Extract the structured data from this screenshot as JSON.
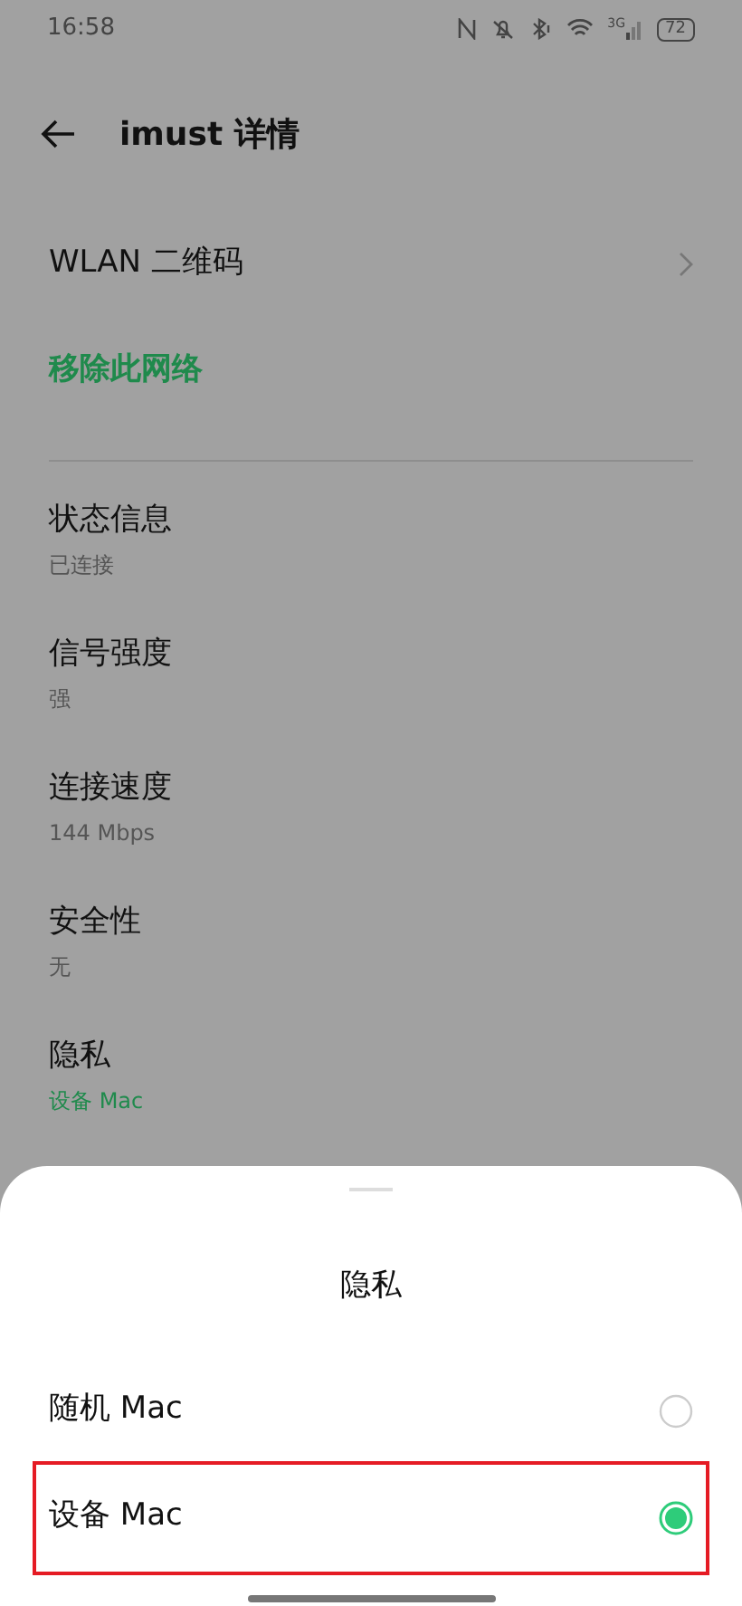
{
  "status_bar": {
    "time": "16:58",
    "network": "3G",
    "battery": "72"
  },
  "header": {
    "title": "imust 详情"
  },
  "actions": [
    {
      "kind": "link",
      "label": "WLAN 二维码"
    },
    {
      "kind": "danger",
      "label": "移除此网络"
    }
  ],
  "details": [
    {
      "label": "状态信息",
      "value": "已连接",
      "accent": false
    },
    {
      "label": "信号强度",
      "value": "强",
      "accent": false
    },
    {
      "label": "连接速度",
      "value": "144 Mbps",
      "accent": false
    },
    {
      "label": "安全性",
      "value": "无",
      "accent": false
    },
    {
      "label": "隐私",
      "value": "设备 Mac",
      "accent": true
    }
  ],
  "sheet": {
    "title": "隐私",
    "options": [
      {
        "label": "随机 Mac",
        "selected": false,
        "highlighted": false
      },
      {
        "label": "设备 Mac",
        "selected": true,
        "highlighted": true
      }
    ]
  }
}
